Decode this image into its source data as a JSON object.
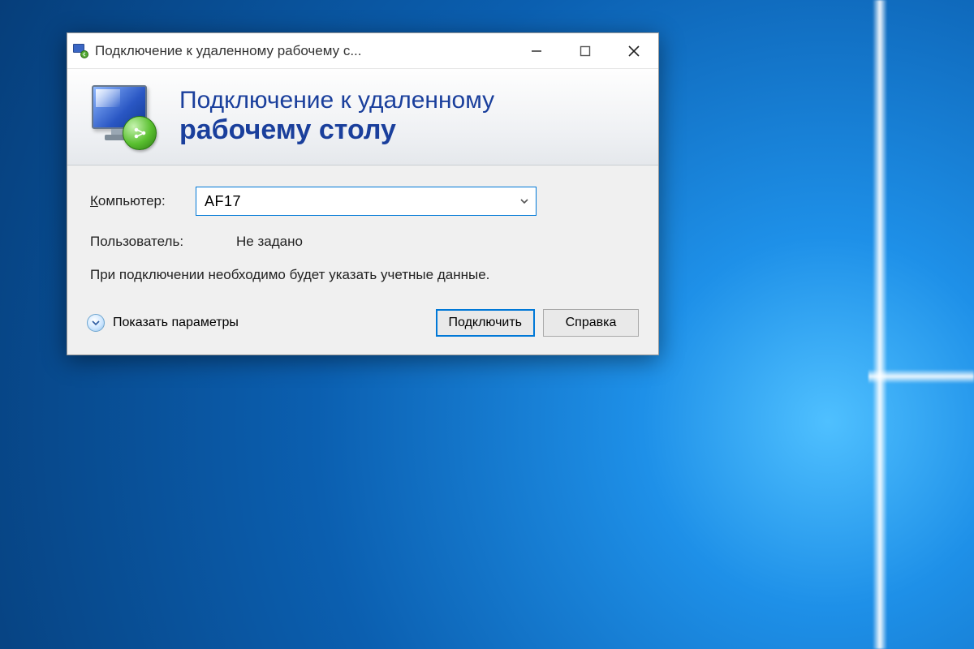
{
  "titlebar": {
    "title": "Подключение к удаленному рабочему с..."
  },
  "banner": {
    "line1": "Подключение к удаленному",
    "line2": "рабочему столу"
  },
  "form": {
    "computer_label": "Компьютер:",
    "computer_value": "AF17",
    "user_label": "Пользователь:",
    "user_value": "Не задано",
    "note": "При подключении необходимо будет указать учетные данные."
  },
  "footer": {
    "show_options": "Показать параметры",
    "connect": "Подключить",
    "help": "Справка"
  }
}
